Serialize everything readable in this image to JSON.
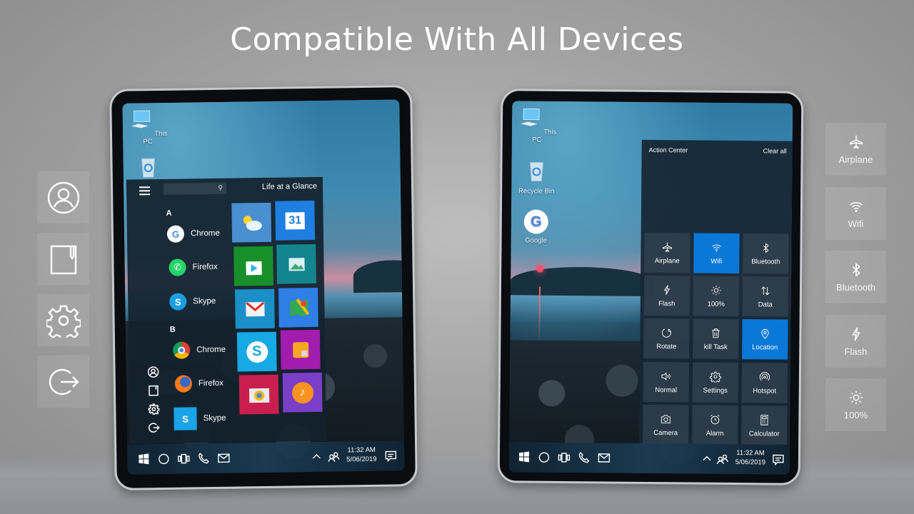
{
  "headline": "Compatible With All Devices",
  "left_sidebar": {
    "items": [
      {
        "icon": "user-circle-icon",
        "label": "Profile"
      },
      {
        "icon": "notebook-icon",
        "label": "Notes"
      },
      {
        "icon": "gear-icon",
        "label": "Settings"
      },
      {
        "icon": "logout-icon",
        "label": "Logout"
      }
    ]
  },
  "right_sidebar": {
    "items": [
      {
        "icon": "airplane-icon",
        "label": "Airplane"
      },
      {
        "icon": "wifi-icon",
        "label": "Wifi"
      },
      {
        "icon": "bluetooth-icon",
        "label": "Bluetooth"
      },
      {
        "icon": "flash-icon",
        "label": "Flash"
      },
      {
        "icon": "brightness-icon",
        "label": "100%"
      }
    ]
  },
  "tablet_left": {
    "desktop_icons": [
      {
        "icon": "computer-icon",
        "label": "This PC"
      },
      {
        "icon": "recycle-bin-icon",
        "label": ""
      }
    ],
    "start_menu": {
      "search_placeholder": "",
      "tiles_header": "Life at a Glance",
      "groups": [
        {
          "letter": "A",
          "apps": [
            {
              "icon": "google-icon",
              "label": "Chrome"
            },
            {
              "icon": "whatsapp-icon",
              "label": "Firefox"
            },
            {
              "icon": "skype-icon",
              "label": "Skype"
            }
          ]
        },
        {
          "letter": "B",
          "apps": [
            {
              "icon": "chrome-icon",
              "label": "Chrome"
            },
            {
              "icon": "firefox-icon",
              "label": "Firefox"
            },
            {
              "icon": "skype-icon",
              "label": "Skype"
            }
          ]
        }
      ],
      "tiles": [
        {
          "name": "weather",
          "color": "#4a8fd0"
        },
        {
          "name": "calendar",
          "color": "#1e7fe0",
          "text": "31"
        },
        {
          "name": "play-store",
          "color": "#17902a"
        },
        {
          "name": "photos",
          "color": "#13858f"
        },
        {
          "name": "gmail",
          "color": "#1b90c8"
        },
        {
          "name": "maps",
          "color": "#2f7fe6"
        },
        {
          "name": "skype",
          "color": "#17a9e3"
        },
        {
          "name": "calculator",
          "color": "#a21caf"
        },
        {
          "name": "camera",
          "color": "#c81f4f"
        },
        {
          "name": "music",
          "color": "#7b3fc7"
        }
      ]
    },
    "taskbar": {
      "time": "11:32 AM",
      "date": "5/06/2019"
    }
  },
  "tablet_right": {
    "desktop_icons": [
      {
        "icon": "computer-icon",
        "label": "This PC"
      },
      {
        "icon": "recycle-bin-icon",
        "label": "Recycle Bin"
      },
      {
        "icon": "google-icon",
        "label": "Google"
      }
    ],
    "action_center": {
      "title": "Action Center",
      "clear_label": "Clear all",
      "active_color": "#0a78d7",
      "tiles": [
        {
          "icon": "airplane-icon",
          "label": "Airplane",
          "active": false
        },
        {
          "icon": "wifi-icon",
          "label": "Wifi",
          "active": true
        },
        {
          "icon": "bluetooth-icon",
          "label": "Bluetooth",
          "active": false
        },
        {
          "icon": "flash-icon",
          "label": "Flash",
          "active": false
        },
        {
          "icon": "brightness-icon",
          "label": "100%",
          "active": false
        },
        {
          "icon": "data-icon",
          "label": "Data",
          "active": false
        },
        {
          "icon": "rotate-icon",
          "label": "Rotate",
          "active": false
        },
        {
          "icon": "trash-icon",
          "label": "kill Task",
          "active": false
        },
        {
          "icon": "location-icon",
          "label": "Location",
          "active": true
        },
        {
          "icon": "volume-icon",
          "label": "Normal",
          "active": false
        },
        {
          "icon": "gear-icon",
          "label": "Settings",
          "active": false
        },
        {
          "icon": "hotspot-icon",
          "label": "Hotspot",
          "active": false
        },
        {
          "icon": "camera-icon",
          "label": "Camera",
          "active": false
        },
        {
          "icon": "alarm-icon",
          "label": "Alarm",
          "active": false
        },
        {
          "icon": "calculator-icon",
          "label": "Calculator",
          "active": false
        }
      ]
    },
    "taskbar": {
      "time": "11:32 AM",
      "date": "5/06/2019"
    }
  }
}
